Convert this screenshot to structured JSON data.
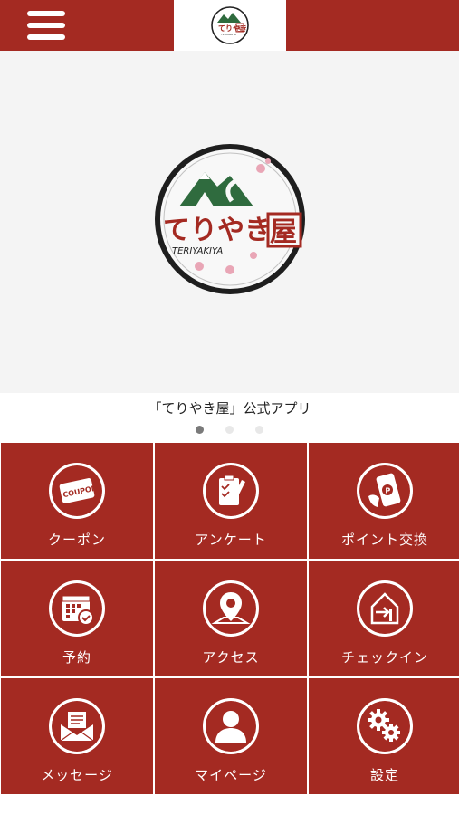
{
  "header": {
    "menu_icon": "hamburger-menu-icon",
    "logo": {
      "brand_jp": "てりやき",
      "brand_kanji": "屋",
      "brand_en": "TERIYAKIYA"
    }
  },
  "hero": {
    "logo": {
      "brand_jp": "てりやき",
      "brand_kanji": "屋",
      "brand_en": "TERIYAKIYA"
    },
    "caption": "「てりやき屋」公式アプリ",
    "slide_count": 3,
    "active_slide": 1
  },
  "colors": {
    "brand_red": "#a42a22",
    "logo_green": "#2f6b3e",
    "blossom_pink": "#e9a6b6"
  },
  "menu": [
    {
      "label": "クーポン",
      "icon": "coupon-icon",
      "icon_text": "COUPON"
    },
    {
      "label": "アンケート",
      "icon": "survey-clipboard-icon"
    },
    {
      "label": "ポイント交換",
      "icon": "point-exchange-phone-icon",
      "icon_text": "P"
    },
    {
      "label": "予約",
      "icon": "calendar-check-icon"
    },
    {
      "label": "アクセス",
      "icon": "map-pin-icon"
    },
    {
      "label": "チェックイン",
      "icon": "check-in-door-icon"
    },
    {
      "label": "メッセージ",
      "icon": "message-envelope-icon"
    },
    {
      "label": "マイページ",
      "icon": "user-profile-icon"
    },
    {
      "label": "設定",
      "icon": "settings-gears-icon"
    }
  ]
}
